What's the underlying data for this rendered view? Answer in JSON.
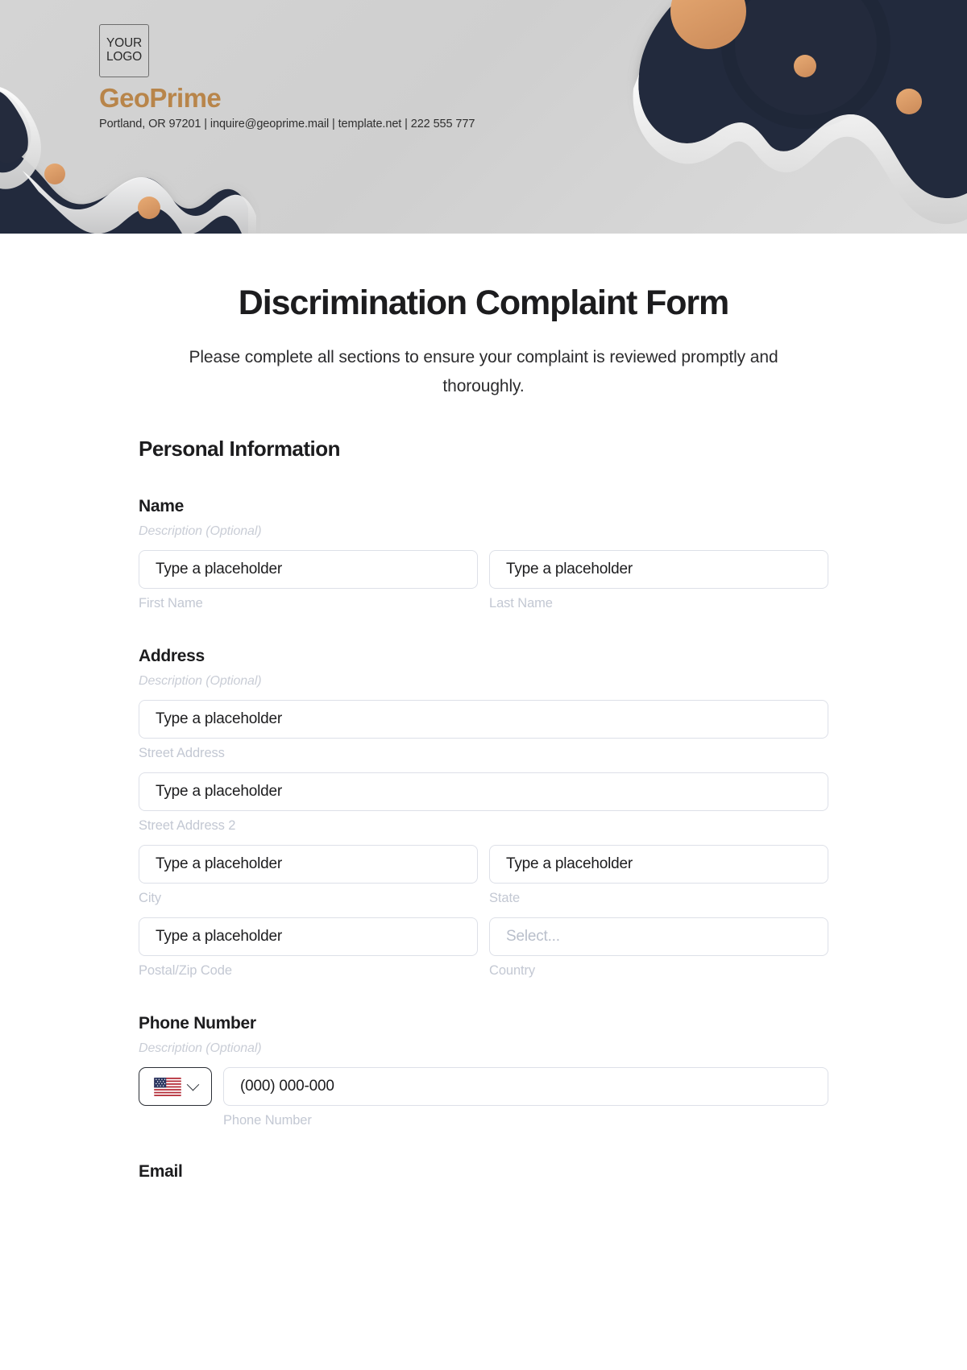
{
  "header": {
    "logo_line1": "YOUR",
    "logo_line2": "LOGO",
    "brand_name": "GeoPrime",
    "contact_line": "Portland, OR 97201 | inquire@geoprime.mail | template.net | 222 555 777",
    "accent_color": "#b8854a",
    "dark_color": "#242b3d",
    "band_color": "#d4d4d4"
  },
  "form": {
    "title": "Discrimination Complaint Form",
    "subtitle": "Please complete all sections to ensure your complaint is reviewed promptly and thoroughly.",
    "section_title": "Personal Information",
    "description_placeholder_text": "Description (Optional)",
    "text_placeholder": "Type a placeholder",
    "select_placeholder": "Select...",
    "phone_placeholder": "(000) 000-000",
    "groups": {
      "name": {
        "label": "Name",
        "description": "Description (Optional)",
        "fields": [
          {
            "sublabel": "First Name",
            "placeholder": "Type a placeholder"
          },
          {
            "sublabel": "Last Name",
            "placeholder": "Type a placeholder"
          }
        ]
      },
      "address": {
        "label": "Address",
        "description": "Description (Optional)",
        "street": {
          "sublabel": "Street Address",
          "placeholder": "Type a placeholder"
        },
        "street2": {
          "sublabel": "Street Address 2",
          "placeholder": "Type a placeholder"
        },
        "city": {
          "sublabel": "City",
          "placeholder": "Type a placeholder"
        },
        "state": {
          "sublabel": "State",
          "placeholder": "Type a placeholder"
        },
        "postal": {
          "sublabel": "Postal/Zip Code",
          "placeholder": "Type a placeholder"
        },
        "country": {
          "sublabel": "Country",
          "placeholder": "Select..."
        }
      },
      "phone": {
        "label": "Phone Number",
        "description": "Description (Optional)",
        "country_flag": "us-flag-icon",
        "sublabel": "Phone Number",
        "placeholder": "(000) 000-000"
      },
      "email": {
        "label": "Email"
      }
    }
  }
}
